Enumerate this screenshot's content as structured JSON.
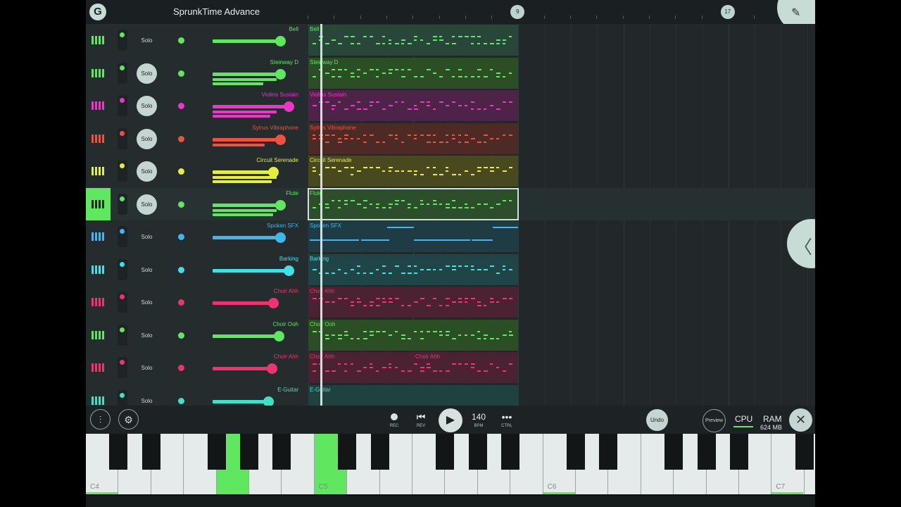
{
  "app": {
    "logo": "G",
    "title": "SprunkTime Advance",
    "corner_icon": "mouse-icon"
  },
  "ruler": {
    "markers": [
      {
        "label": "9",
        "bar": 9
      },
      {
        "label": "17",
        "bar": 17
      }
    ]
  },
  "channels": [
    {
      "name": "Bell",
      "color": "#5fe85f",
      "solo": "Solo",
      "solo_active": false,
      "volume": 0.8,
      "subs": []
    },
    {
      "name": "Steinway D",
      "color": "#5fe85f",
      "solo": "Solo",
      "solo_active": true,
      "volume": 0.8,
      "subs": [
        0.76,
        0.6
      ]
    },
    {
      "name": "Violins Sustain",
      "color": "#ee34c9",
      "solo": "Solo",
      "solo_active": true,
      "volume": 0.9,
      "subs": [
        0.76,
        0.68
      ]
    },
    {
      "name": "Sytrus Vibraphone",
      "color": "#f0503f",
      "solo": "Solo",
      "solo_active": true,
      "volume": 0.8,
      "subs": [
        0.62
      ]
    },
    {
      "name": "Circuit Serenade",
      "color": "#e6ee3c",
      "solo": "Solo",
      "solo_active": true,
      "volume": 0.72,
      "subs": [
        0.76,
        0.7
      ]
    },
    {
      "name": "Flute",
      "color": "#5fe85f",
      "solo": "Solo",
      "solo_active": true,
      "volume": 0.8,
      "subs": [
        0.76,
        0.72
      ]
    },
    {
      "name": "Spoken SFX",
      "color": "#3fb6ee",
      "solo": "Solo",
      "solo_active": false,
      "volume": 0.8,
      "subs": []
    },
    {
      "name": "Barking",
      "color": "#3fe0e8",
      "solo": "Solo",
      "solo_active": false,
      "volume": 0.9,
      "subs": []
    },
    {
      "name": "Choir Ahh",
      "color": "#f0336e",
      "solo": "Solo",
      "solo_active": false,
      "volume": 0.72,
      "subs": []
    },
    {
      "name": "Choir Ooh",
      "color": "#5fe85f",
      "solo": "Solo",
      "solo_active": false,
      "volume": 0.78,
      "subs": []
    },
    {
      "name": "Choir Ahh",
      "color": "#f0336e",
      "solo": "Solo",
      "solo_active": false,
      "volume": 0.7,
      "subs": []
    },
    {
      "name": "E-Guitar",
      "color": "#3fe0c8",
      "solo": "Solo",
      "solo_active": false,
      "volume": 0.66,
      "subs": []
    }
  ],
  "playlist": {
    "patterns": [
      {
        "label": "Bell",
        "bg": "#28463a",
        "note": "#5fe85f",
        "style": "dash",
        "selected": false
      },
      {
        "label": "Steinway D",
        "bg": "#2c4e25",
        "note": "#5fe85f",
        "style": "dash",
        "selected": false
      },
      {
        "label": "Violins Sustain",
        "bg": "#4d2447",
        "note": "#ee34c9",
        "style": "dash",
        "selected": false
      },
      {
        "label": "Sytrus Vibraphone",
        "bg": "#4e2a24",
        "note": "#f0503f",
        "style": "dash",
        "selected": false
      },
      {
        "label": "Circuit Serenade",
        "bg": "#48491f",
        "note": "#e6ee3c",
        "style": "dash",
        "selected": false
      },
      {
        "label": "Flute",
        "bg": "#2c4e2a",
        "note": "#5fe85f",
        "style": "dash",
        "selected": true
      },
      {
        "label": "Spoken SFX",
        "bg": "#1f3b44",
        "note": "#3fb6ee",
        "style": "line",
        "selected": false
      },
      {
        "label": "Barking",
        "bg": "#1f4546",
        "note": "#3fe0e8",
        "style": "dash",
        "selected": false
      },
      {
        "label": "Choir Ahh",
        "bg": "#4a2232",
        "note": "#f0336e",
        "style": "dash",
        "selected": false
      },
      {
        "label": "Choir Ooh",
        "bg": "#2c4e25",
        "note": "#5fe85f",
        "style": "dash",
        "selected": false
      },
      {
        "label": "Choir Ahh",
        "bg": "#4a2232",
        "note": "#f0336e",
        "style": "dash",
        "selected": false,
        "label2": "Choir Ahh"
      },
      {
        "label": "E-Guitar",
        "bg": "#1f4240",
        "note": "#3fe0c8",
        "style": "flat",
        "selected": false
      }
    ]
  },
  "transport": {
    "rec_label": "REC",
    "rev_label": "REV",
    "tempo": "140",
    "bpm_label": "BPM",
    "ctrl_label": "CTRL",
    "undo": "Undo",
    "preview": "Preview",
    "cpu": "CPU",
    "ram": "RAM",
    "ram_value": "624 MB"
  },
  "keyboard": {
    "octave_labels": [
      "C4",
      "C5",
      "C6",
      "C7"
    ],
    "pressed_white": [
      4,
      7
    ]
  },
  "icons": {
    "mixer": "mixer-icon",
    "piano_settings": "piano-settings-icon",
    "side_panel": "chevron-left-icon",
    "close": "close-icon"
  }
}
